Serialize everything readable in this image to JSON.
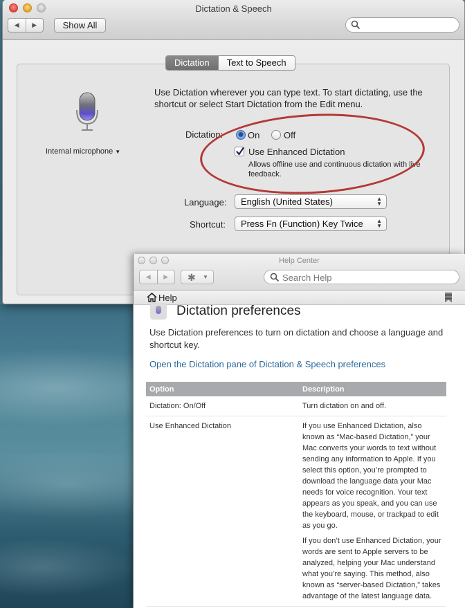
{
  "prefs_window": {
    "title": "Dictation & Speech",
    "show_all_label": "Show All",
    "tabs": [
      {
        "label": "Dictation",
        "active": true
      },
      {
        "label": "Text to Speech",
        "active": false
      }
    ],
    "intro_text": "Use Dictation wherever you can type text. To start dictating, use the shortcut or select Start Dictation from the Edit menu.",
    "microphone_label": "Internal microphone",
    "dictation": {
      "label": "Dictation:",
      "on_label": "On",
      "off_label": "Off",
      "selected": "On"
    },
    "enhanced": {
      "label": "Use Enhanced Dictation",
      "checked": true,
      "description": "Allows offline use and continuous dictation with live feedback."
    },
    "language": {
      "label": "Language:",
      "value": "English (United States)"
    },
    "shortcut": {
      "label": "Shortcut:",
      "value": "Press Fn (Function) Key Twice"
    },
    "annotation_color": "#b23a36"
  },
  "help_window": {
    "title": "Help Center",
    "search_placeholder": "Search Help",
    "home_label": "Help",
    "heading": "Dictation preferences",
    "intro": "Use Dictation preferences to turn on dictation and choose a language and shortcut key.",
    "link": "Open the Dictation pane of Dictation & Speech preferences",
    "table": {
      "headers": [
        "Option",
        "Description"
      ],
      "rows": [
        {
          "option": "Dictation: On/Off",
          "description": [
            "Turn dictation on and off."
          ]
        },
        {
          "option": "Use Enhanced Dictation",
          "description": [
            "If you use Enhanced Dictation, also known as “Mac-based Dictation,” your Mac converts your words to text without sending any information to Apple. If you select this option, you’re prompted to download the language data your Mac needs for voice recognition. Your text appears as you speak, and you can use the keyboard, mouse, or trackpad to edit as you go.",
            "If you don’t use Enhanced Dictation, your words are sent to Apple servers to be analyzed, helping your Mac understand what you’re saying. This method, also known as “server-based Dictation,” takes advantage of the latest language data."
          ]
        }
      ]
    }
  }
}
